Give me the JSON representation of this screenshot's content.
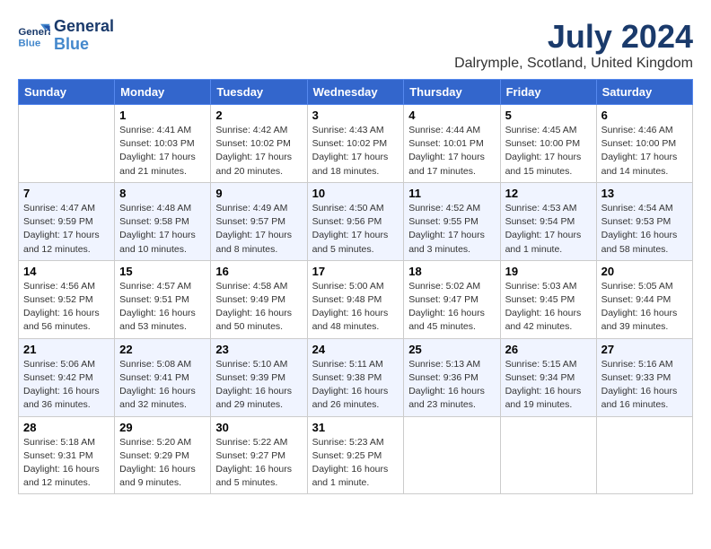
{
  "header": {
    "logo_line1": "General",
    "logo_line2": "Blue",
    "month_year": "July 2024",
    "location": "Dalrymple, Scotland, United Kingdom"
  },
  "columns": [
    "Sunday",
    "Monday",
    "Tuesday",
    "Wednesday",
    "Thursday",
    "Friday",
    "Saturday"
  ],
  "weeks": [
    [
      {
        "day": "",
        "info": ""
      },
      {
        "day": "1",
        "info": "Sunrise: 4:41 AM\nSunset: 10:03 PM\nDaylight: 17 hours\nand 21 minutes."
      },
      {
        "day": "2",
        "info": "Sunrise: 4:42 AM\nSunset: 10:02 PM\nDaylight: 17 hours\nand 20 minutes."
      },
      {
        "day": "3",
        "info": "Sunrise: 4:43 AM\nSunset: 10:02 PM\nDaylight: 17 hours\nand 18 minutes."
      },
      {
        "day": "4",
        "info": "Sunrise: 4:44 AM\nSunset: 10:01 PM\nDaylight: 17 hours\nand 17 minutes."
      },
      {
        "day": "5",
        "info": "Sunrise: 4:45 AM\nSunset: 10:00 PM\nDaylight: 17 hours\nand 15 minutes."
      },
      {
        "day": "6",
        "info": "Sunrise: 4:46 AM\nSunset: 10:00 PM\nDaylight: 17 hours\nand 14 minutes."
      }
    ],
    [
      {
        "day": "7",
        "info": "Sunrise: 4:47 AM\nSunset: 9:59 PM\nDaylight: 17 hours\nand 12 minutes."
      },
      {
        "day": "8",
        "info": "Sunrise: 4:48 AM\nSunset: 9:58 PM\nDaylight: 17 hours\nand 10 minutes."
      },
      {
        "day": "9",
        "info": "Sunrise: 4:49 AM\nSunset: 9:57 PM\nDaylight: 17 hours\nand 8 minutes."
      },
      {
        "day": "10",
        "info": "Sunrise: 4:50 AM\nSunset: 9:56 PM\nDaylight: 17 hours\nand 5 minutes."
      },
      {
        "day": "11",
        "info": "Sunrise: 4:52 AM\nSunset: 9:55 PM\nDaylight: 17 hours\nand 3 minutes."
      },
      {
        "day": "12",
        "info": "Sunrise: 4:53 AM\nSunset: 9:54 PM\nDaylight: 17 hours\nand 1 minute."
      },
      {
        "day": "13",
        "info": "Sunrise: 4:54 AM\nSunset: 9:53 PM\nDaylight: 16 hours\nand 58 minutes."
      }
    ],
    [
      {
        "day": "14",
        "info": "Sunrise: 4:56 AM\nSunset: 9:52 PM\nDaylight: 16 hours\nand 56 minutes."
      },
      {
        "day": "15",
        "info": "Sunrise: 4:57 AM\nSunset: 9:51 PM\nDaylight: 16 hours\nand 53 minutes."
      },
      {
        "day": "16",
        "info": "Sunrise: 4:58 AM\nSunset: 9:49 PM\nDaylight: 16 hours\nand 50 minutes."
      },
      {
        "day": "17",
        "info": "Sunrise: 5:00 AM\nSunset: 9:48 PM\nDaylight: 16 hours\nand 48 minutes."
      },
      {
        "day": "18",
        "info": "Sunrise: 5:02 AM\nSunset: 9:47 PM\nDaylight: 16 hours\nand 45 minutes."
      },
      {
        "day": "19",
        "info": "Sunrise: 5:03 AM\nSunset: 9:45 PM\nDaylight: 16 hours\nand 42 minutes."
      },
      {
        "day": "20",
        "info": "Sunrise: 5:05 AM\nSunset: 9:44 PM\nDaylight: 16 hours\nand 39 minutes."
      }
    ],
    [
      {
        "day": "21",
        "info": "Sunrise: 5:06 AM\nSunset: 9:42 PM\nDaylight: 16 hours\nand 36 minutes."
      },
      {
        "day": "22",
        "info": "Sunrise: 5:08 AM\nSunset: 9:41 PM\nDaylight: 16 hours\nand 32 minutes."
      },
      {
        "day": "23",
        "info": "Sunrise: 5:10 AM\nSunset: 9:39 PM\nDaylight: 16 hours\nand 29 minutes."
      },
      {
        "day": "24",
        "info": "Sunrise: 5:11 AM\nSunset: 9:38 PM\nDaylight: 16 hours\nand 26 minutes."
      },
      {
        "day": "25",
        "info": "Sunrise: 5:13 AM\nSunset: 9:36 PM\nDaylight: 16 hours\nand 23 minutes."
      },
      {
        "day": "26",
        "info": "Sunrise: 5:15 AM\nSunset: 9:34 PM\nDaylight: 16 hours\nand 19 minutes."
      },
      {
        "day": "27",
        "info": "Sunrise: 5:16 AM\nSunset: 9:33 PM\nDaylight: 16 hours\nand 16 minutes."
      }
    ],
    [
      {
        "day": "28",
        "info": "Sunrise: 5:18 AM\nSunset: 9:31 PM\nDaylight: 16 hours\nand 12 minutes."
      },
      {
        "day": "29",
        "info": "Sunrise: 5:20 AM\nSunset: 9:29 PM\nDaylight: 16 hours\nand 9 minutes."
      },
      {
        "day": "30",
        "info": "Sunrise: 5:22 AM\nSunset: 9:27 PM\nDaylight: 16 hours\nand 5 minutes."
      },
      {
        "day": "31",
        "info": "Sunrise: 5:23 AM\nSunset: 9:25 PM\nDaylight: 16 hours\nand 1 minute."
      },
      {
        "day": "",
        "info": ""
      },
      {
        "day": "",
        "info": ""
      },
      {
        "day": "",
        "info": ""
      }
    ]
  ]
}
